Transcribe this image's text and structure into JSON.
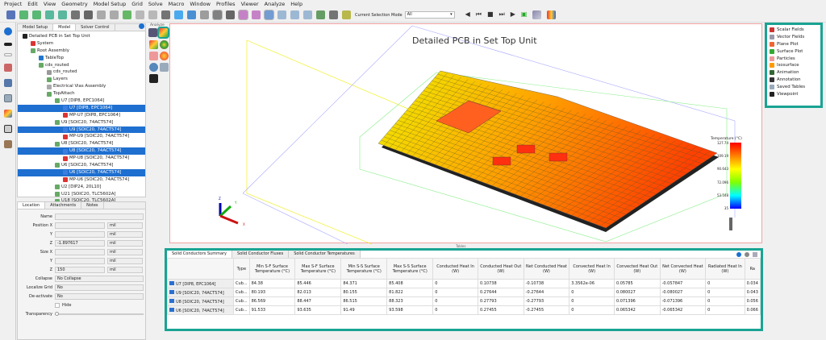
{
  "menu": [
    "Project",
    "Edit",
    "View",
    "Geometry",
    "Model Setup",
    "Grid",
    "Solve",
    "Macro",
    "Window",
    "Profiles",
    "Viewer",
    "Analyze",
    "Help"
  ],
  "toolbar": {
    "selection_mode_label": "Current Selection Mode",
    "selection_mode_value": "All"
  },
  "tree_panel": {
    "tabs": [
      "Model Setup",
      "Model",
      "Solver Control"
    ],
    "active_tab": "Model",
    "items": [
      {
        "label": "Detailed PCB in Set Top Unit",
        "indent": 0,
        "selected": false
      },
      {
        "label": "System",
        "indent": 1,
        "selected": false
      },
      {
        "label": "Root Assembly",
        "indent": 1,
        "selected": false
      },
      {
        "label": "TableTop",
        "indent": 2,
        "selected": false
      },
      {
        "label": "cds_routed",
        "indent": 2,
        "selected": false
      },
      {
        "label": "cds_routed",
        "indent": 3,
        "selected": false
      },
      {
        "label": "Layers",
        "indent": 3,
        "selected": false
      },
      {
        "label": "Electrical Vias Assembly",
        "indent": 3,
        "selected": false
      },
      {
        "label": "TopAttach",
        "indent": 3,
        "selected": false
      },
      {
        "label": "U7 [DIP8, EPC1064]",
        "indent": 4,
        "selected": false
      },
      {
        "label": "U7 [DIP8, EPC1064]",
        "indent": 5,
        "selected": true
      },
      {
        "label": "MP-U7 [DIP8, EPC1064]",
        "indent": 5,
        "selected": false
      },
      {
        "label": "U9 [SOIC20, 74ACT574]",
        "indent": 4,
        "selected": false
      },
      {
        "label": "U9 [SOIC20, 74ACT574]",
        "indent": 5,
        "selected": true
      },
      {
        "label": "MP-U9 [SOIC20, 74ACT574]",
        "indent": 5,
        "selected": false
      },
      {
        "label": "U8 [SOIC20, 74ACT574]",
        "indent": 4,
        "selected": false
      },
      {
        "label": "U8 [SOIC20, 74ACT574]",
        "indent": 5,
        "selected": true
      },
      {
        "label": "MP-U8 [SOIC20, 74ACT574]",
        "indent": 5,
        "selected": false
      },
      {
        "label": "U6 [SOIC20, 74ACT574]",
        "indent": 4,
        "selected": false
      },
      {
        "label": "U6 [SOIC20, 74ACT574]",
        "indent": 5,
        "selected": true
      },
      {
        "label": "MP-U6 [SOIC20, 74ACT574]",
        "indent": 5,
        "selected": false
      },
      {
        "label": "U2 [DIP24, 20L10]",
        "indent": 4,
        "selected": false
      },
      {
        "label": "U21 [SOIC20, TLC5602A]",
        "indent": 4,
        "selected": false
      },
      {
        "label": "U18 [SOIC20, TLC5602A]",
        "indent": 4,
        "selected": false
      }
    ]
  },
  "properties": {
    "tabs": [
      "Location",
      "Attachments",
      "Notes"
    ],
    "name_label": "Name",
    "position_x_label": "Position X",
    "y_label": "Y",
    "z_label": "Z",
    "size_x_label": "Size X",
    "unit": "mil",
    "position_z": "-1.897617",
    "size_z": "150",
    "collapse_label": "Collapse",
    "collapse_value": "No Collapse",
    "localize_label": "Localize Grid",
    "localize_value": "No",
    "deactivate_label": "De-activate",
    "deactivate_value": "No",
    "hide_label": "Hide",
    "transparency_label": "Transparency",
    "transparency": 0
  },
  "analyze": {
    "label": "Analyze"
  },
  "viewport": {
    "title": "Detailed PCB in Set Top Unit",
    "axes": [
      "X",
      "Y",
      "Z"
    ],
    "legend": {
      "title": "Temperature (°C)",
      "ticks": [
        "127.74",
        "109.19",
        "90.643",
        "72.096",
        "53.548",
        "35"
      ],
      "colors": [
        "#ff0000",
        "#ff8000",
        "#ffff00",
        "#80ff00",
        "#00ffff",
        "#0000ff"
      ]
    }
  },
  "right_tree": [
    "Scalar Fields",
    "Vector Fields",
    "Plane Plot",
    "Surface Plot",
    "Particles",
    "Isosurface",
    "Animation",
    "Annotation",
    "Saved Tables",
    "Viewpoint"
  ],
  "table": {
    "title": "Tables",
    "tabs": [
      "Solid Conductors Summary",
      "Solid Conductor Fluxes",
      "Solid Conductor Temperatures"
    ],
    "columns": [
      "Type",
      "Min S-F Surface Temperature (°C)",
      "Max S-F Surface Temperature (°C)",
      "Min S-S Surface Temperature (°C)",
      "Max S-S Surface Temperature (°C)",
      "Conducted Heat In (W)",
      "Conducted Heat Out (W)",
      "Net Conducted Heat (W)",
      "Convected Heat In (W)",
      "Convected Heat Out (W)",
      "Net Convected Heat (W)",
      "Radiated Heat In (W)",
      "Ra"
    ],
    "rows": [
      {
        "name": "U7 [DIP8, EPC1064]",
        "cells": [
          "Cub...",
          "84.38",
          "85.446",
          "84.371",
          "85.408",
          "0",
          "0.10738",
          "-0.10738",
          "3.3562e-06",
          "0.05785",
          "-0.057847",
          "0",
          "0.034"
        ]
      },
      {
        "name": "U9 [SOIC20, 74ACT574]",
        "cells": [
          "Cub...",
          "80.193",
          "82.013",
          "80.155",
          "81.822",
          "0",
          "0.27644",
          "-0.27644",
          "0",
          "0.080027",
          "-0.080027",
          "0",
          "0.043"
        ]
      },
      {
        "name": "U8 [SOIC20, 74ACT574]",
        "cells": [
          "Cub...",
          "86.569",
          "88.447",
          "86.515",
          "88.323",
          "0",
          "0.27793",
          "-0.27793",
          "0",
          "0.071396",
          "-0.071396",
          "0",
          "0.056"
        ]
      },
      {
        "name": "U6 [SOIC20, 74ACT574]",
        "cells": [
          "Cub...",
          "91.533",
          "93.635",
          "91.49",
          "93.598",
          "0",
          "0.27455",
          "-0.27455",
          "0",
          "0.065342",
          "-0.065342",
          "0",
          "0.066"
        ]
      }
    ]
  },
  "colors": {
    "highlight": "#1aa393",
    "selection": "#1e6fd0"
  }
}
